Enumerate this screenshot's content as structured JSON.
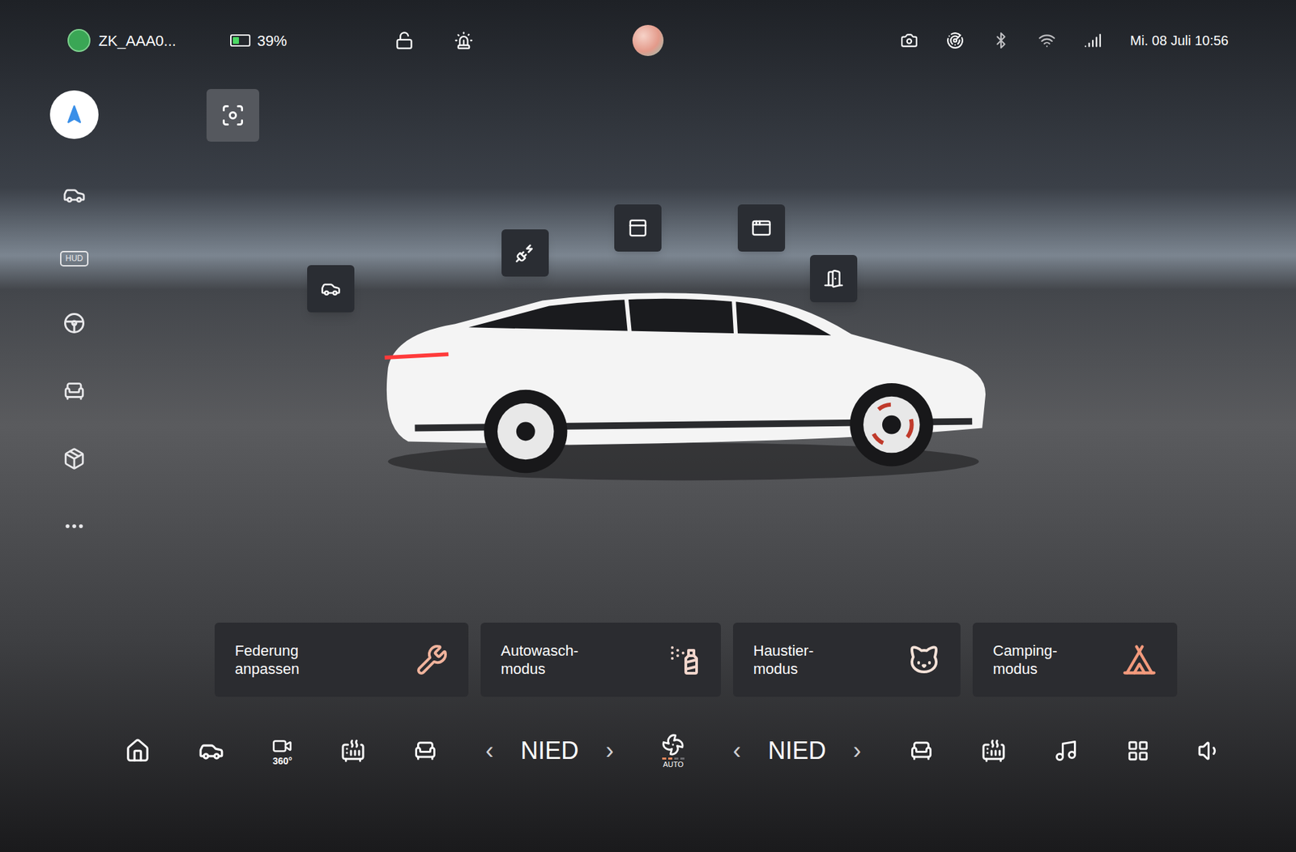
{
  "status_bar": {
    "profile": "ZK_AAA0...",
    "battery": "39%",
    "battery_level": 0.39,
    "locked": false,
    "datetime": "Mi. 08 Juli 10:56"
  },
  "sidebar": {
    "hud_label": "HUD"
  },
  "mode_cards": [
    {
      "label": "Federung\nanpassen",
      "kind": "suspension"
    },
    {
      "label": "Autowasch-\nmodus",
      "kind": "carwash"
    },
    {
      "label": "Haustier-\nmodus",
      "kind": "pet"
    },
    {
      "label": "Camping-\nmodus",
      "kind": "camping"
    }
  ],
  "climate": {
    "left": {
      "prev": "‹",
      "value": "NIED",
      "next": "›"
    },
    "fan": "AUTO",
    "right": {
      "prev": "‹",
      "value": "NIED",
      "next": "›"
    }
  },
  "dock": {
    "camera_label": "360°"
  }
}
